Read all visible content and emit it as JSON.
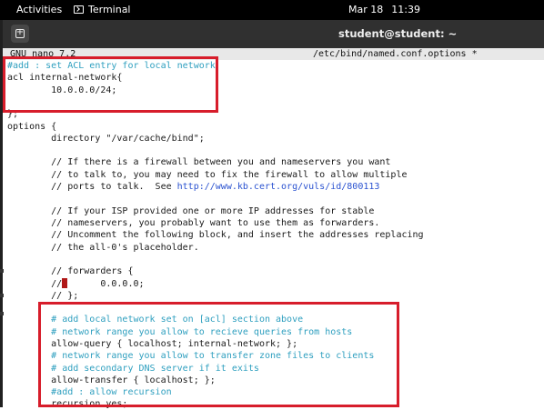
{
  "topbar": {
    "activities": "Activities",
    "app_name": "Terminal",
    "date": "Mar 18",
    "time": "11:39"
  },
  "window": {
    "title": "student@student: ~"
  },
  "nano": {
    "version": "GNU nano 7.2",
    "filename": "/etc/bind/named.conf.options *"
  },
  "lines": [
    {
      "text": "#add : set ACL entry for local network",
      "comment": true
    },
    {
      "text": "acl internal-network{",
      "comment": false
    },
    {
      "text": "        10.0.0.0/24;",
      "comment": false
    },
    {
      "text": "",
      "comment": false
    },
    {
      "text": "};",
      "comment": false
    },
    {
      "text": "options {",
      "comment": false
    },
    {
      "text": "        directory \"/var/cache/bind\";",
      "comment": false
    },
    {
      "text": "",
      "comment": false
    },
    {
      "text": "        // If there is a firewall between you and nameservers you want",
      "comment": false
    },
    {
      "text": "        // to talk to, you may need to fix the firewall to allow multiple",
      "comment": false
    },
    {
      "text": "        // ports to talk.  See ",
      "comment": false,
      "url": "http://www.kb.cert.org/vuls/id/800113"
    },
    {
      "text": "",
      "comment": false
    },
    {
      "text": "        // If your ISP provided one or more IP addresses for stable",
      "comment": false
    },
    {
      "text": "        // nameservers, you probably want to use them as forwarders.",
      "comment": false
    },
    {
      "text": "        // Uncomment the following block, and insert the addresses replacing",
      "comment": false
    },
    {
      "text": "        // the all-0's placeholder.",
      "comment": false
    },
    {
      "text": "",
      "comment": false
    },
    {
      "text": "        // forwarders {",
      "comment": false
    },
    {
      "text": "        //",
      "comment": false,
      "cursor": true,
      "after": "      0.0.0.0;"
    },
    {
      "text": "        // };",
      "comment": false
    },
    {
      "text": "",
      "comment": false
    },
    {
      "text": "        # add local network set on [acl] section above",
      "comment": true
    },
    {
      "text": "        # network range you allow to recieve queries from hosts",
      "comment": true
    },
    {
      "text": "        allow-query { localhost; internal-network; };",
      "comment": false
    },
    {
      "text": "        # network range you allow to transfer zone files to clients",
      "comment": true
    },
    {
      "text": "        # add secondary DNS server if it exits",
      "comment": true
    },
    {
      "text": "        allow-transfer { localhost; };",
      "comment": false
    },
    {
      "text": "        #add : allow recursion",
      "comment": true
    },
    {
      "text": "        recursion yes;",
      "comment": false
    }
  ]
}
